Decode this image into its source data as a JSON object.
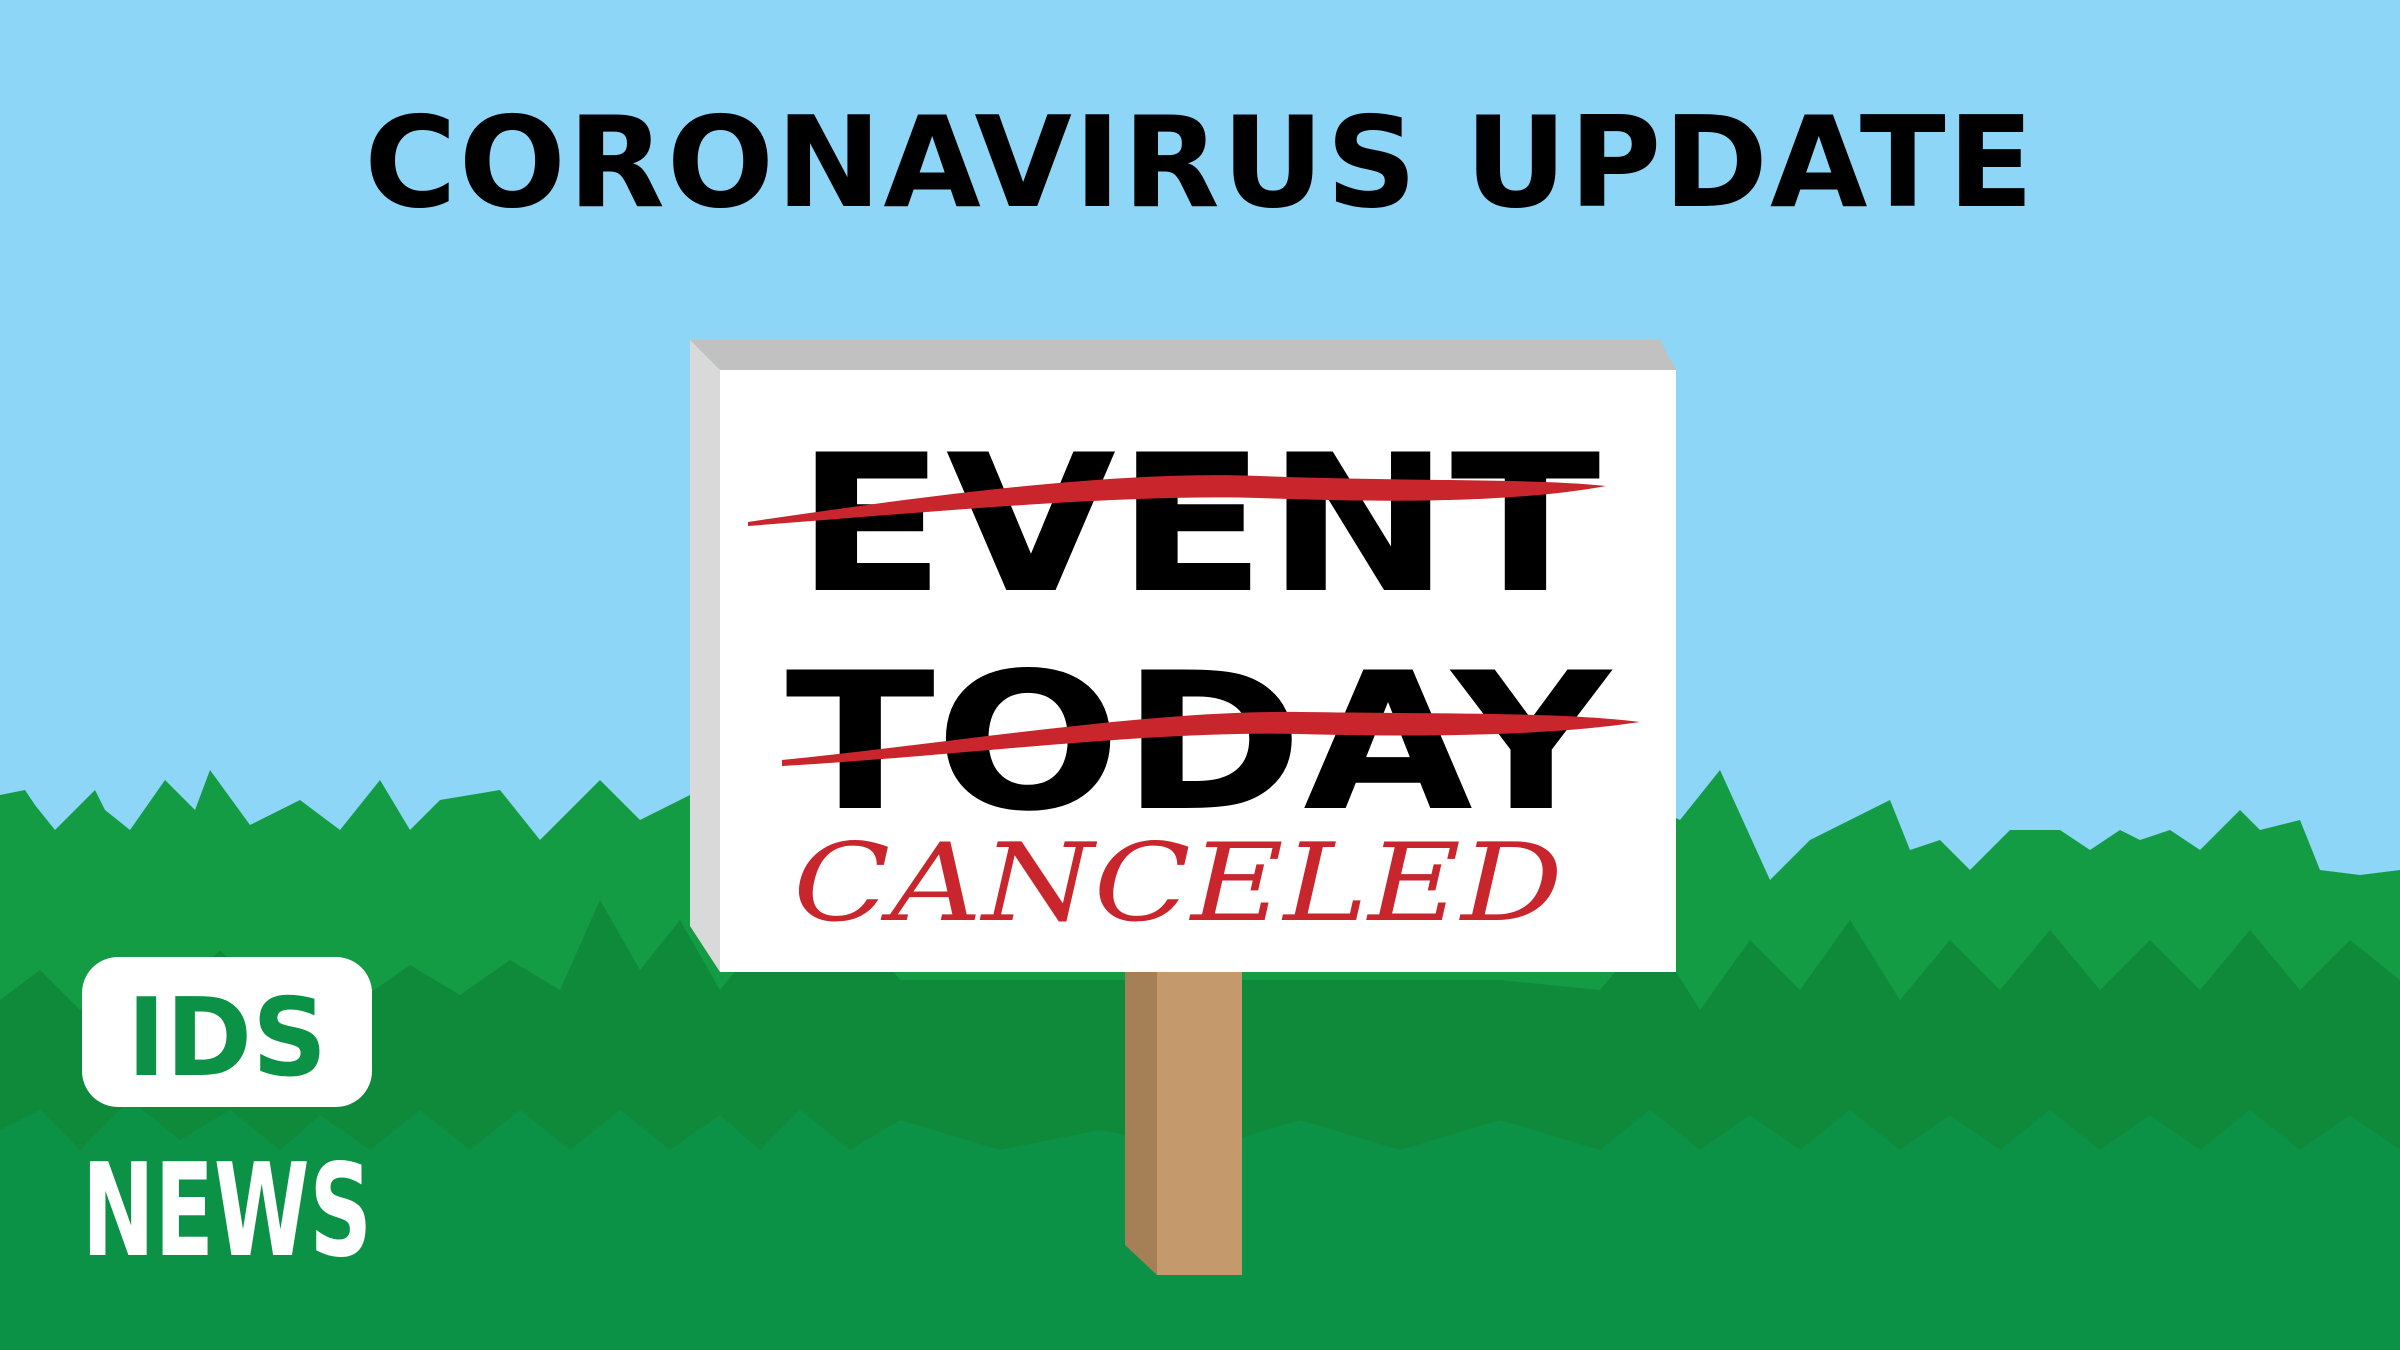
{
  "headline": "CORONAVIRUS UPDATE",
  "sign": {
    "line1": "EVENT",
    "line2": "TODAY",
    "stamp": "CANCELED"
  },
  "logo": {
    "badge": "IDS",
    "word": "NEWS"
  },
  "colors": {
    "sky": "#8dd6f7",
    "grass_front": "#0c9246",
    "grass_mid": "#0e8a3a",
    "grass_back": "#149c45",
    "strike": "#c8252c",
    "post": "#c49a6c",
    "post_shadow": "#a57f55",
    "sign_face": "#ffffff",
    "sign_edge": "#c1c1c1"
  }
}
